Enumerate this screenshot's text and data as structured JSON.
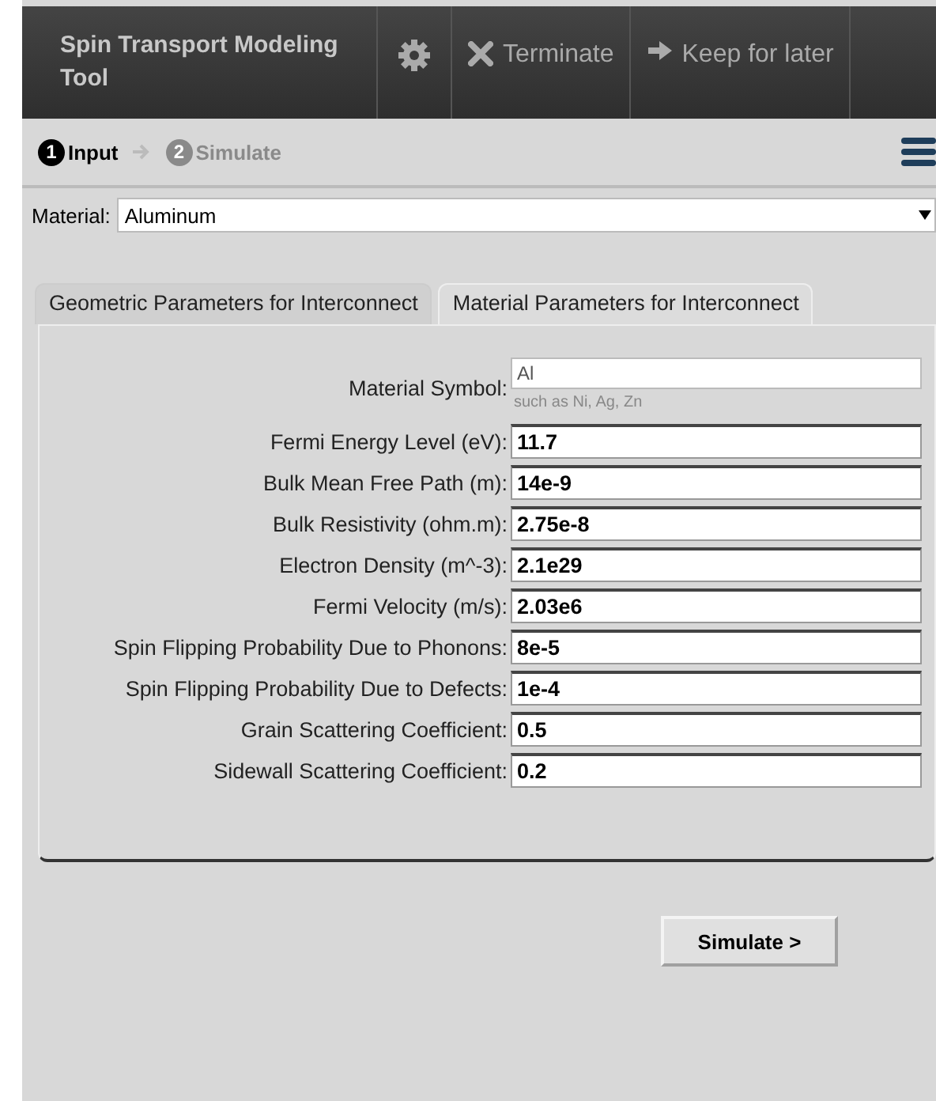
{
  "header": {
    "title": "Spin Transport Modeling Tool",
    "actions": [
      {
        "kind": "settings"
      },
      {
        "kind": "terminate",
        "label": "Terminate"
      },
      {
        "kind": "keep",
        "label": "Keep for later"
      }
    ]
  },
  "steps": [
    {
      "number": "1",
      "label": "Input",
      "selected": true
    },
    {
      "number": "2",
      "label": "Simulate",
      "selected": false
    }
  ],
  "material": {
    "label": "Material:",
    "value": "Aluminum"
  },
  "tabs": [
    {
      "label": "Geometric Parameters for Interconnect",
      "selected": false
    },
    {
      "label": "Material Parameters for Interconnect",
      "selected": true
    }
  ],
  "fields": [
    {
      "label": "Material Symbol:",
      "value": "Al",
      "hint": "such as Ni, Ag, Zn",
      "kind": "text"
    },
    {
      "label": "Fermi Energy Level (eV):",
      "value": "11.7",
      "kind": "number"
    },
    {
      "label": "Bulk Mean Free Path (m):",
      "value": "14e-9",
      "kind": "number"
    },
    {
      "label": "Bulk Resistivity (ohm.m):",
      "value": "2.75e-8",
      "kind": "number"
    },
    {
      "label": "Electron Density (m^-3):",
      "value": "2.1e29",
      "kind": "number"
    },
    {
      "label": "Fermi Velocity (m/s):",
      "value": "2.03e6",
      "kind": "number"
    },
    {
      "label": "Spin Flipping Probability Due to Phonons:",
      "value": "8e-5",
      "kind": "number"
    },
    {
      "label": "Spin Flipping Probability Due to Defects:",
      "value": "1e-4",
      "kind": "number"
    },
    {
      "label": "Grain Scattering Coefficient:",
      "value": "0.5",
      "kind": "number"
    },
    {
      "label": "Sidewall Scattering Coefficient:",
      "value": "0.2",
      "kind": "number"
    }
  ],
  "simulate_button": "Simulate >"
}
